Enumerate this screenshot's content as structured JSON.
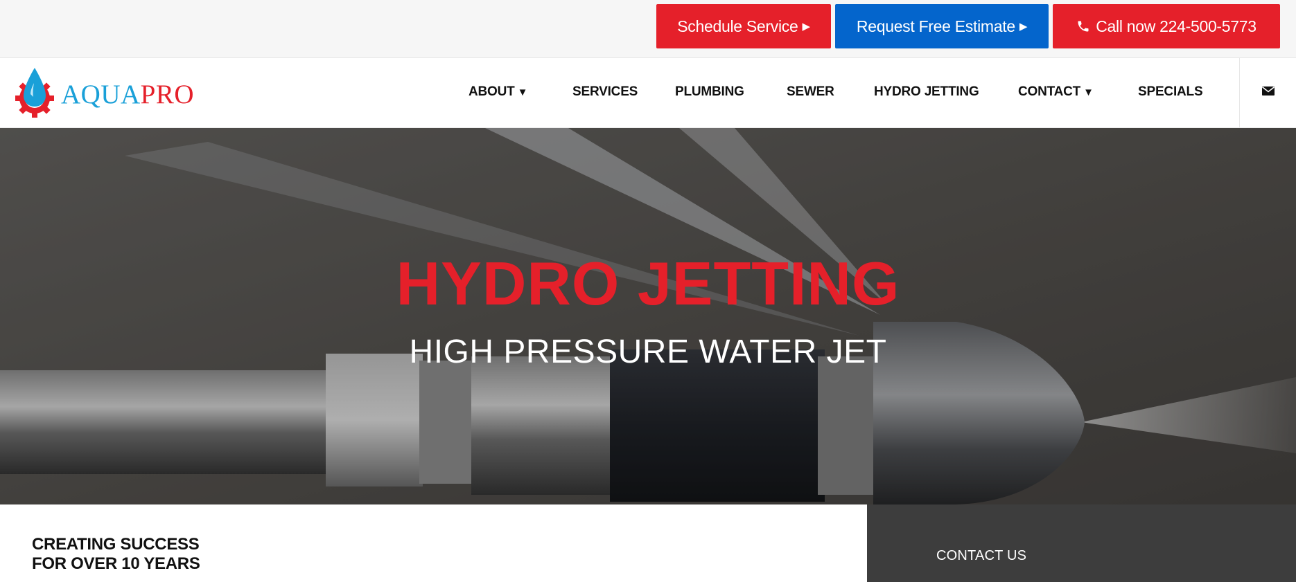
{
  "topbar": {
    "schedule_label": "Schedule Service",
    "estimate_label": "Request Free Estimate",
    "call_label": "Call now 224-500-5773",
    "arrow_glyph": "▶",
    "colors": {
      "red": "#e5202a",
      "blue": "#0465cc"
    }
  },
  "logo": {
    "aqua": "AQUA",
    "pro": "PRO"
  },
  "nav": {
    "items": [
      {
        "label": "ABOUT",
        "has_dropdown": true
      },
      {
        "label": "SERVICES",
        "has_dropdown": false
      },
      {
        "label": "PLUMBING",
        "has_dropdown": false
      },
      {
        "label": "SEWER",
        "has_dropdown": false
      },
      {
        "label": "HYDRO JETTING",
        "has_dropdown": false
      },
      {
        "label": "CONTACT",
        "has_dropdown": true
      },
      {
        "label": "SPECIALS",
        "has_dropdown": false
      }
    ],
    "caret_glyph": "▼",
    "mail_icon": "envelope-icon"
  },
  "hero": {
    "title": "HYDRO JETTING",
    "subtitle": "HIGH PRESSURE WATER JET"
  },
  "bottom": {
    "tagline_line1": "CREATING SUCCESS",
    "tagline_line2": "FOR OVER 10 YEARS",
    "contact_title": "CONTACT US"
  }
}
